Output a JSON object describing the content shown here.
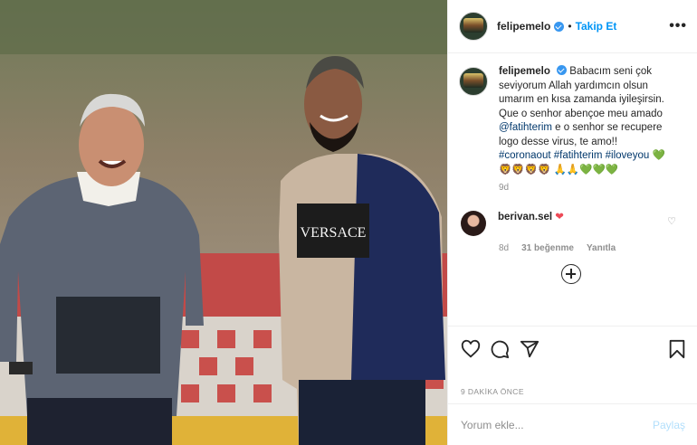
{
  "post": {
    "username": "felipemelo",
    "follow_label": "Takip Et",
    "separator": "•",
    "more_label": "•••",
    "photo_text": "VERSACE"
  },
  "caption": {
    "username": "felipemelo",
    "line1": "Babacım seni çok seviyorum Allah yardımcın olsun umarım en kısa zamanda iyileşirsin. Que o senhor abençoe meu amado ",
    "mention": "@fatihterim",
    "line2": " e o senhor se recupere logo desse virus, te amo!! ",
    "tag1": "#coronaout",
    "tag2": "#fatihterim",
    "tag3": "#iloveyou",
    "emojis1": "💚🦁🦁🦁🦁",
    "emojis2": "🙏🙏",
    "emojis3": "💚💚💚",
    "time": "9d"
  },
  "comment": {
    "username": "berivan.sel",
    "text": "❤",
    "time": "8d",
    "likes": "31 beğenme",
    "reply": "Yanıtla"
  },
  "icons": [
    "heart-icon",
    "comment-icon",
    "share-icon",
    "bookmark-icon",
    "plus-circle-icon"
  ],
  "timestamp": "9 DAKİKA ÖNCE",
  "add_comment": {
    "placeholder": "Yorum ekle...",
    "submit": "Paylaş"
  },
  "colors": {
    "link": "#00376b",
    "accent": "#0095f6",
    "heart": "#ed4956"
  }
}
